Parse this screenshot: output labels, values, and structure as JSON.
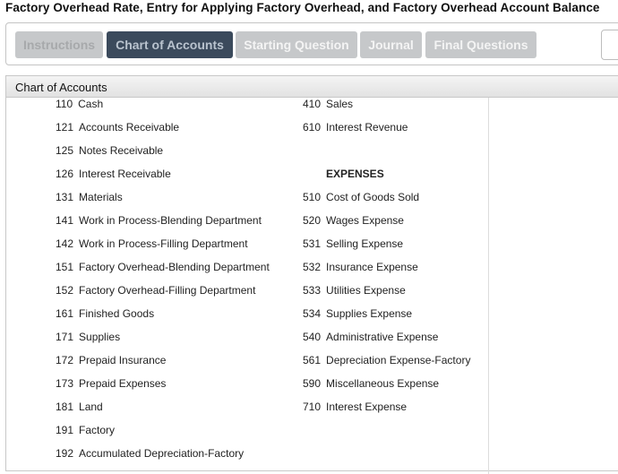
{
  "title": "Factory Overhead Rate, Entry for Applying Factory Overhead, and Factory Overhead Account Balance",
  "tabs": [
    {
      "label": "Instructions"
    },
    {
      "label": "Chart of Accounts"
    },
    {
      "label": "Starting Question"
    },
    {
      "label": "Journal"
    },
    {
      "label": "Final Questions"
    }
  ],
  "panel": {
    "header": "Chart of Accounts"
  },
  "left_accounts": [
    {
      "num": "110",
      "name": "Cash"
    },
    {
      "num": "121",
      "name": "Accounts Receivable"
    },
    {
      "num": "125",
      "name": "Notes Receivable"
    },
    {
      "num": "126",
      "name": "Interest Receivable"
    },
    {
      "num": "131",
      "name": "Materials"
    },
    {
      "num": "141",
      "name": "Work in Process-Blending Department"
    },
    {
      "num": "142",
      "name": "Work in Process-Filling Department"
    },
    {
      "num": "151",
      "name": "Factory Overhead-Blending Department"
    },
    {
      "num": "152",
      "name": "Factory Overhead-Filling Department"
    },
    {
      "num": "161",
      "name": "Finished Goods"
    },
    {
      "num": "171",
      "name": "Supplies"
    },
    {
      "num": "172",
      "name": "Prepaid Insurance"
    },
    {
      "num": "173",
      "name": "Prepaid Expenses"
    },
    {
      "num": "181",
      "name": "Land"
    },
    {
      "num": "191",
      "name": "Factory"
    },
    {
      "num": "192",
      "name": "Accumulated Depreciation-Factory"
    }
  ],
  "revenue_accounts": [
    {
      "num": "410",
      "name": "Sales"
    },
    {
      "num": "610",
      "name": "Interest Revenue"
    }
  ],
  "expenses_heading": "EXPENSES",
  "expense_accounts": [
    {
      "num": "510",
      "name": "Cost of Goods Sold"
    },
    {
      "num": "520",
      "name": "Wages Expense"
    },
    {
      "num": "531",
      "name": "Selling Expense"
    },
    {
      "num": "532",
      "name": "Insurance Expense"
    },
    {
      "num": "533",
      "name": "Utilities Expense"
    },
    {
      "num": "534",
      "name": "Supplies Expense"
    },
    {
      "num": "540",
      "name": "Administrative Expense"
    },
    {
      "num": "561",
      "name": "Depreciation Expense-Factory"
    },
    {
      "num": "590",
      "name": "Miscellaneous Expense"
    },
    {
      "num": "710",
      "name": "Interest Expense"
    }
  ]
}
